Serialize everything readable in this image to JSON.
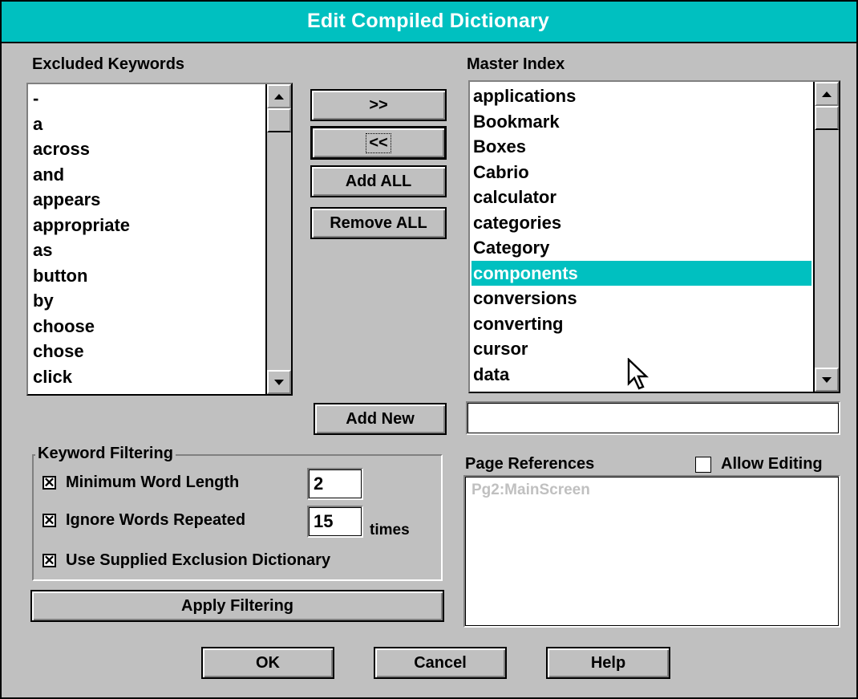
{
  "window": {
    "title": "Edit Compiled Dictionary"
  },
  "excluded": {
    "label": "Excluded Keywords",
    "items": [
      "-",
      "a",
      "across",
      "and",
      "appears",
      "appropriate",
      "as",
      "button",
      "by",
      "choose",
      "chose",
      "click"
    ]
  },
  "master": {
    "label": "Master Index",
    "items": [
      "applications",
      "Bookmark",
      "Boxes",
      "Cabrio",
      "calculator",
      "categories",
      "Category",
      "components",
      "conversions",
      "converting",
      "cursor",
      "data"
    ],
    "selected_index": 7
  },
  "buttons": {
    "add": ">>",
    "remove": "<<",
    "add_all": "Add ALL",
    "remove_all": "Remove ALL",
    "add_new": "Add New",
    "apply_filtering": "Apply Filtering",
    "ok": "OK",
    "cancel": "Cancel",
    "help": "Help"
  },
  "new_entry": {
    "value": ""
  },
  "filtering": {
    "label": "Keyword Filtering",
    "min_length": {
      "label": "Minimum Word Length",
      "checked": true,
      "value": "2"
    },
    "ignore_repeated": {
      "label": "Ignore Words Repeated",
      "checked": true,
      "value": "15",
      "suffix": "times"
    },
    "use_exclusion": {
      "label": "Use Supplied Exclusion Dictionary",
      "checked": true
    }
  },
  "page_refs": {
    "label": "Page References",
    "allow_editing": {
      "label": "Allow Editing",
      "checked": false
    },
    "items": [
      "Pg2:MainScreen"
    ]
  },
  "colors": {
    "titlebar": "#00c0c0",
    "selection": "#00c0c0",
    "face": "#c0c0c0"
  }
}
